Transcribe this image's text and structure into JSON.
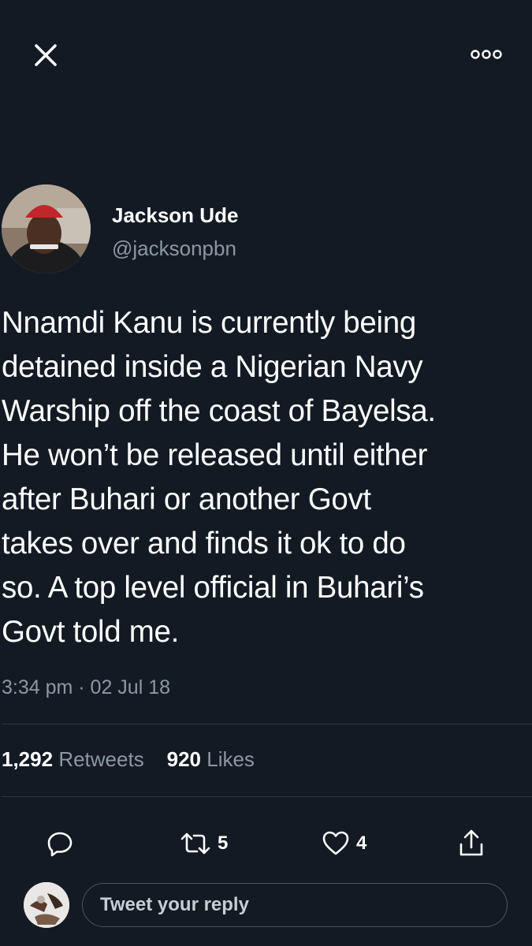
{
  "tweet": {
    "author_name": "Jackson Ude",
    "author_handle": "@jacksonpbn",
    "text_lines": [
      "Nnamdi Kanu is currently being",
      "detained inside a Nigerian Navy",
      "Warship off the coast of Bayelsa.",
      "He won’t be released until either",
      "after Buhari or another Govt",
      "takes over and finds it ok to do",
      "so. A top level official in Buhari’s",
      "Govt told me."
    ],
    "timestamp": "3:34 pm · 02 Jul 18",
    "retweets_count": "1,292",
    "retweets_label": "Retweets",
    "likes_count": "920",
    "likes_label": "Likes"
  },
  "actions": {
    "reply_icon": "reply-icon",
    "retweet_icon": "retweet-icon",
    "retweet_count": "5",
    "like_icon": "heart-icon",
    "like_count": "4",
    "share_icon": "share-icon"
  },
  "reply": {
    "placeholder": "Tweet your reply"
  },
  "header": {
    "close_icon": "close-icon",
    "more_icon": "more-options-icon"
  },
  "colors": {
    "background": "#141a24",
    "text_primary": "#ffffff",
    "text_secondary": "#8b98a5"
  }
}
